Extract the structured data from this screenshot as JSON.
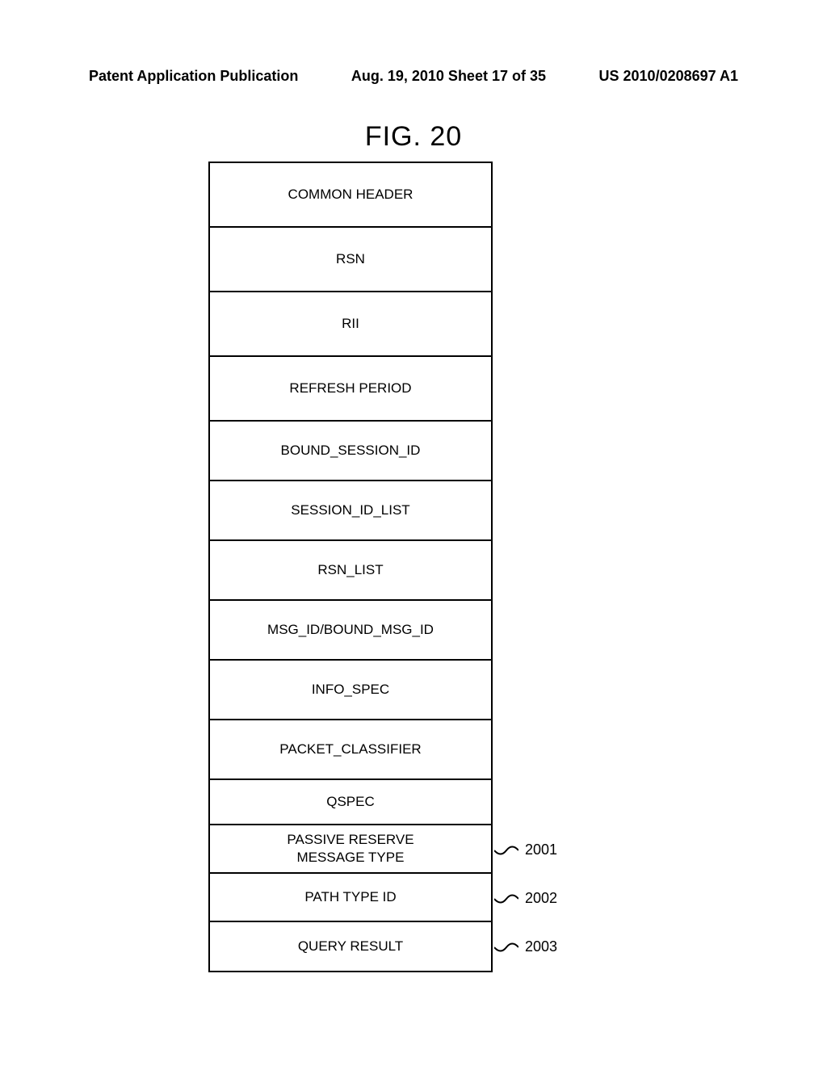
{
  "header": {
    "left": "Patent Application Publication",
    "center": "Aug. 19, 2010  Sheet 17 of 35",
    "right": "US 2010/0208697 A1"
  },
  "figure_title": "FIG. 20",
  "rows": [
    {
      "label": "COMMON HEADER",
      "height": "cell-tall",
      "ref": ""
    },
    {
      "label": "RSN",
      "height": "cell-tall",
      "ref": ""
    },
    {
      "label": "RII",
      "height": "cell-tall",
      "ref": ""
    },
    {
      "label": "REFRESH PERIOD",
      "height": "cell-tall",
      "ref": ""
    },
    {
      "label": "BOUND_SESSION_ID",
      "height": "cell-mid",
      "ref": ""
    },
    {
      "label": "SESSION_ID_LIST",
      "height": "cell-mid",
      "ref": ""
    },
    {
      "label": "RSN_LIST",
      "height": "cell-mid",
      "ref": ""
    },
    {
      "label": "MSG_ID/BOUND_MSG_ID",
      "height": "cell-mid",
      "ref": ""
    },
    {
      "label": "INFO_SPEC",
      "height": "cell-mid",
      "ref": ""
    },
    {
      "label": "PACKET_CLASSIFIER",
      "height": "cell-mid",
      "ref": ""
    },
    {
      "label": "QSPEC",
      "height": "cell-qspec",
      "ref": ""
    },
    {
      "label": "PASSIVE RESERVE\nMESSAGE TYPE",
      "height": "cell-short",
      "ref": "2001"
    },
    {
      "label": "PATH TYPE ID",
      "height": "cell-short",
      "ref": "2002"
    },
    {
      "label": "QUERY RESULT",
      "height": "cell-short",
      "ref": "2003"
    }
  ]
}
